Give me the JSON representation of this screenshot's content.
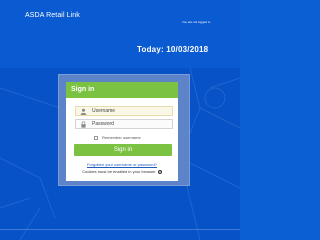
{
  "header": {
    "app_title": "ASDA Retail Link",
    "login_status": "You are not logged in.",
    "today_label": "Today: 10/03/2018"
  },
  "login": {
    "title": "Sign in",
    "username_placeholder": "Username",
    "password_placeholder": "Password",
    "remember_label": "Remember username",
    "signin_label": "Sign in",
    "forgot_link": "Forgotten your username or password?",
    "cookies_notice": "Cookies must be enabled in your browser",
    "help_glyph": "?"
  },
  "icons": {
    "username": "user-icon",
    "password": "padlock-icon",
    "help": "help-icon"
  },
  "colors": {
    "header_bg": "#0a5ad1",
    "accent_green": "#7bc142",
    "link_blue": "#1e5bbf",
    "card_bg": "#ffffff"
  }
}
